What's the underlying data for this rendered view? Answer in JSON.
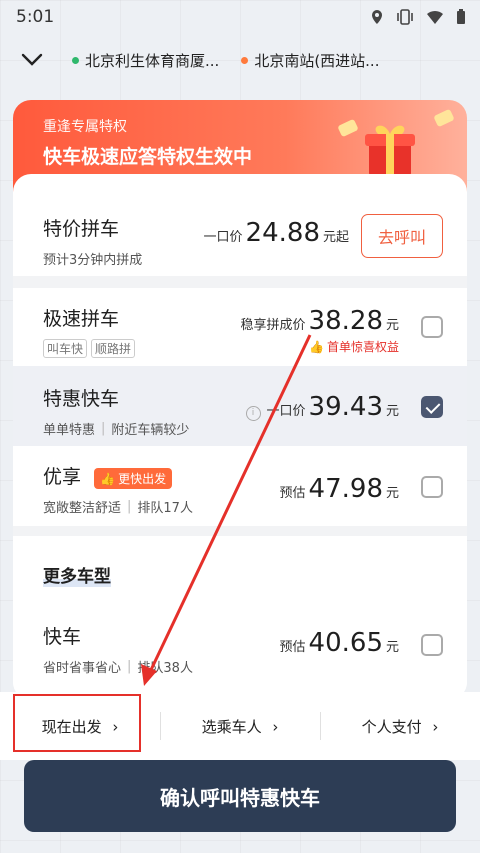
{
  "statusbar": {
    "time": "5:01"
  },
  "route": {
    "from": "北京利生体育商厦...",
    "to": "北京南站(西进站...",
    "from_color": "#2fb86c",
    "to_color": "#ff7a3c"
  },
  "promo": {
    "subtitle": "重逢专属特权",
    "title": "快车极速应答特权生效中"
  },
  "rows": {
    "special_pool": {
      "title": "特价拼车",
      "sub": "预计3分钟内拼成",
      "price_label": "一口价",
      "price": "24.88",
      "unit": "元起",
      "button": "去呼叫"
    },
    "fast_pool": {
      "title": "极速拼车",
      "tags": [
        "叫车快",
        "顺路拼"
      ],
      "price_label": "稳享拼成价",
      "price": "38.28",
      "unit": "元",
      "bonus": "首单惊喜权益",
      "checked": false
    },
    "special_express": {
      "title": "特惠快车",
      "sub1": "单单特惠",
      "sub2": "附近车辆较少",
      "price_label": "一口价",
      "price": "39.43",
      "unit": "元",
      "checked": true
    },
    "premier": {
      "title": "优享",
      "badge": "更快出发",
      "sub1": "宽敞整洁舒适",
      "sub2": "排队17人",
      "price_label": "预估",
      "price": "47.98",
      "unit": "元",
      "checked": false
    },
    "more_header": "更多车型",
    "express": {
      "title": "快车",
      "sub1": "省时省事省心",
      "sub2": "排队38人",
      "price_label": "预估",
      "price": "40.65",
      "unit": "元",
      "checked": false
    }
  },
  "bottom": {
    "depart": "现在出发",
    "passenger": "选乘车人",
    "payment": "个人支付"
  },
  "confirm_button": "确认呼叫特惠快车",
  "colors": {
    "accent": "#ff5a3c",
    "confirm": "#2d3d55",
    "selected": "#4b5771",
    "annotation": "#e5302a"
  }
}
